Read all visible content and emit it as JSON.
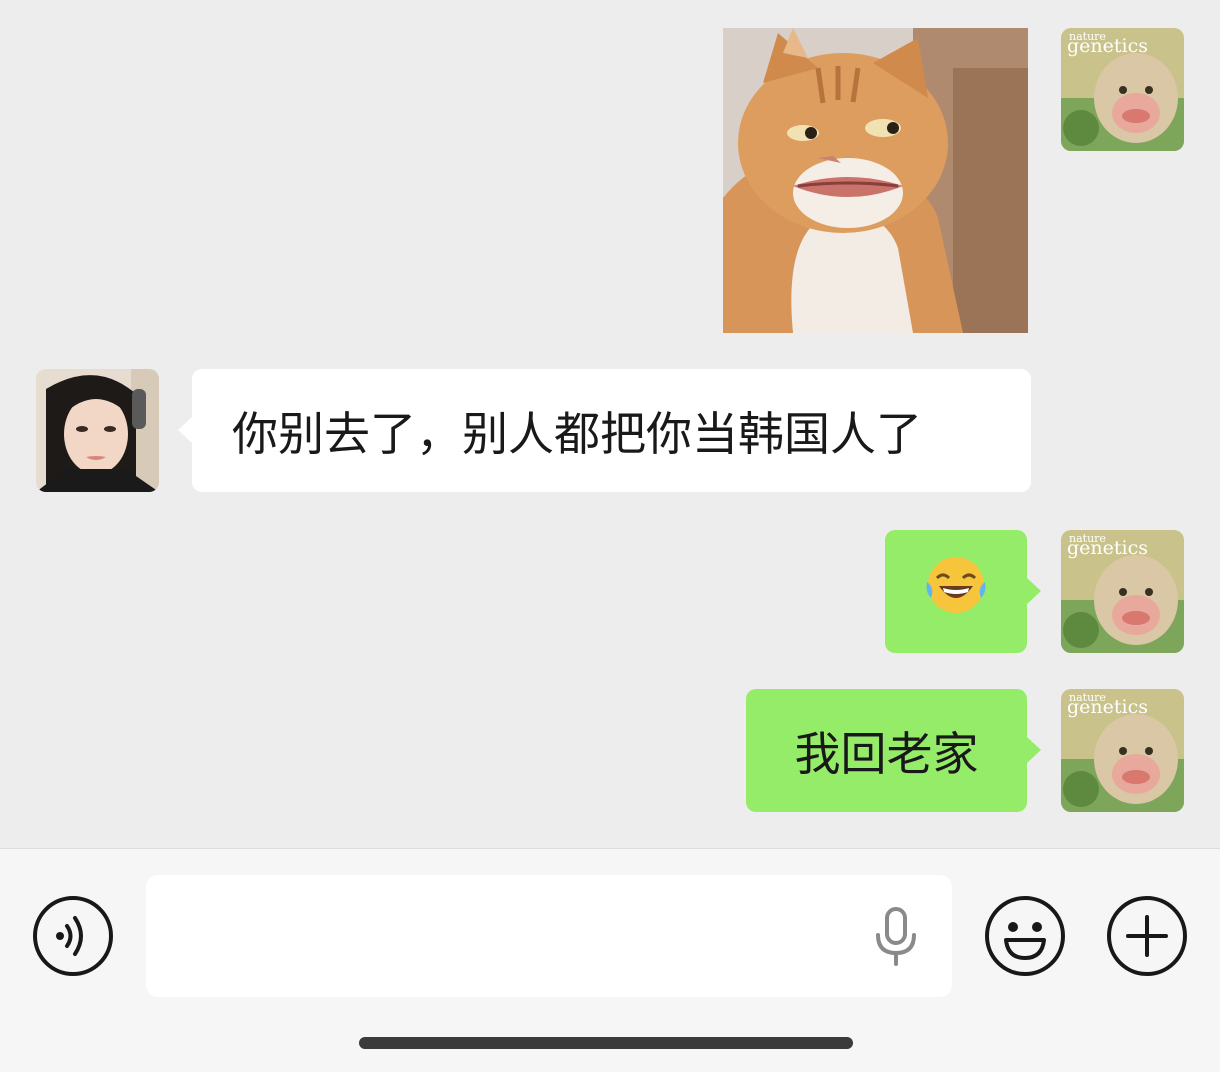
{
  "chat": {
    "messages": [
      {
        "side": "right",
        "type": "sticker",
        "sticker": "cat-meme-sticker"
      },
      {
        "side": "left",
        "type": "text",
        "text": "你别去了，别人都把你当韩国人了"
      },
      {
        "side": "right",
        "type": "emoji",
        "emoji": "😂"
      },
      {
        "side": "right",
        "type": "text",
        "text": "我回老家"
      }
    ],
    "my_avatar": {
      "label_top": "nature",
      "label_main": "genetics"
    }
  },
  "input_bar": {
    "text_value": "",
    "placeholder": "",
    "icons": [
      "voice-mode-icon",
      "microphone-icon",
      "emoji-icon",
      "plus-icon"
    ]
  },
  "colors": {
    "background": "#ededed",
    "bubble_sent": "#95ec69",
    "bubble_received": "#ffffff",
    "input_bar": "#f6f6f6"
  }
}
